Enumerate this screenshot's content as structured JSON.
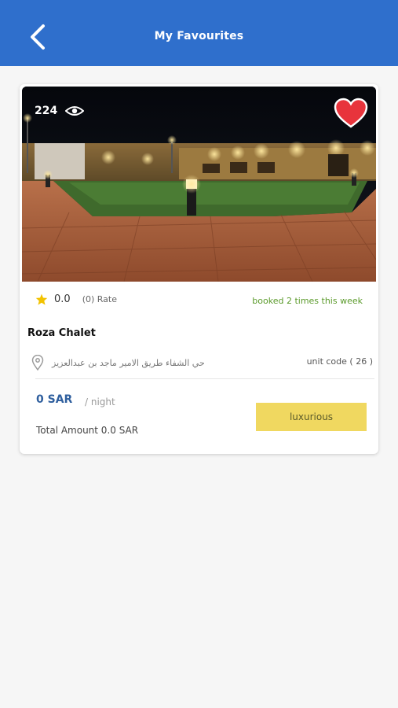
{
  "header": {
    "title": "My Favourites",
    "back_icon": "chevron-left-icon"
  },
  "colors": {
    "header_bg": "#2f6fcc",
    "heart": "#e8343c",
    "star": "#f2c200",
    "category_bg": "#f0d860",
    "booked_text": "#5a9a2a",
    "price_text": "#2f5f9e"
  },
  "favourites": [
    {
      "views": "224",
      "views_icon": "eye-icon",
      "favourite_icon": "heart-icon",
      "rating": "0.0",
      "rate_label": "(0) Rate",
      "booked_text": "booked 2 times this week",
      "name": "Roza Chalet",
      "address": "حي الشفاء طريق الامير ماجد بن عبدالعزيز",
      "location_icon": "location-pin-icon",
      "unit_code": "unit code ( 26 )",
      "price": "0 SAR",
      "per_night": "/ night",
      "total_amount": "Total Amount 0.0 SAR",
      "category": "luxurious"
    }
  ]
}
